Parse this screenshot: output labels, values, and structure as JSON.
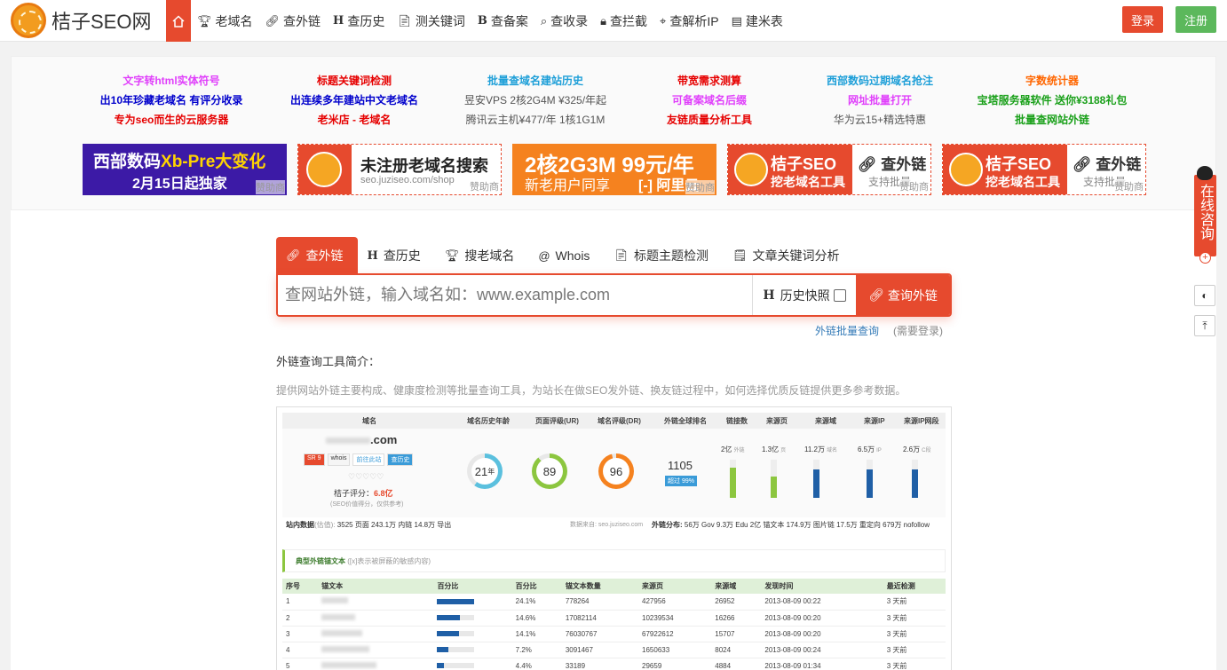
{
  "site": {
    "logo_text": "桔子SEO网"
  },
  "nav": {
    "items": [
      {
        "icon": "trophy-icon",
        "glyph": "🏆︎",
        "label": "老域名"
      },
      {
        "icon": "link-icon",
        "glyph": "🔗︎",
        "label": "查外链"
      },
      {
        "icon": "history-icon",
        "glyph": "H",
        "label": "查历史"
      },
      {
        "icon": "document-icon",
        "glyph": "📄︎",
        "label": "测关键词"
      },
      {
        "icon": "beian-icon",
        "glyph": "B",
        "label": "查备案"
      },
      {
        "icon": "search-icon",
        "glyph": "⌕",
        "label": "查收录"
      },
      {
        "icon": "lock-icon",
        "glyph": "🔒︎",
        "label": "查拦截"
      },
      {
        "icon": "location-icon",
        "glyph": "⌖",
        "label": "查解析IP"
      },
      {
        "icon": "table-icon",
        "glyph": "▤",
        "label": "建米表"
      }
    ],
    "login": "登录",
    "register": "注册"
  },
  "ads": {
    "columns": [
      [
        "文字转html实体符号",
        "出10年珍藏老域名 有评分收录",
        "专为seo而生的云服务器"
      ],
      [
        "标题关键词检测",
        "出连续多年建站中文老域名",
        "老米店 - 老域名"
      ],
      [
        "批量查域名建站历史",
        "昱安VPS 2核2G4M ¥325/年起",
        "腾讯云主机¥477/年 1核1G1M"
      ],
      [
        "带宽需求测算",
        "可备案域名后缀",
        "友链质量分析工具"
      ],
      [
        "西部数码过期域名抢注",
        "网址批量打开",
        "华为云15+精选特惠"
      ],
      [
        "字数统计器",
        "宝塔服务器软件 送你¥3188礼包",
        "批量查网站外链"
      ]
    ],
    "colors": [
      [
        "#e040fb",
        "#0000cc",
        "#e60000"
      ],
      [
        "#e60000",
        "#0000cc",
        "#e60000"
      ],
      [
        "#1e9fd8",
        "#555555",
        "#555555"
      ],
      [
        "#e60000",
        "#e040fb",
        "#e60000"
      ],
      [
        "#1e9fd8",
        "#e040fb",
        "#555555"
      ],
      [
        "#ff6600",
        "#1aa01a",
        "#1aa01a"
      ]
    ],
    "banners": {
      "b1_l1_pre": "西部数码",
      "b1_l1_hl": "Xb-Pre大变化",
      "b1_l2": "2月15日起独家",
      "b2_t1": "未注册老域名搜索",
      "b2_t2": "seo.juziseo.com/shop",
      "b3_t1": "2核2G3M 99元/年",
      "b3_t2": "新老用户同享",
      "b3_t3": "[-] 阿里云",
      "b4_t1": "桔子SEO",
      "b4_t2": "挖老域名工具",
      "b4_wl": "🔗︎ 查外链",
      "b4_wl2": "支持批量",
      "sponsor": "赞助商"
    }
  },
  "tabs": [
    {
      "icon": "link-icon",
      "glyph": "🔗︎",
      "label": "查外链"
    },
    {
      "icon": "history-icon",
      "glyph": "H",
      "label": "查历史"
    },
    {
      "icon": "trophy-icon",
      "glyph": "🏆︎",
      "label": "搜老域名"
    },
    {
      "icon": "at-icon",
      "glyph": "@",
      "label": "Whois"
    },
    {
      "icon": "document-icon",
      "glyph": "📄︎",
      "label": "标题主题检测"
    },
    {
      "icon": "note-icon",
      "glyph": "🗒︎",
      "label": "文章关键词分析"
    }
  ],
  "search": {
    "placeholder": "查网站外链，输入域名如：www.example.com",
    "history_label": "历史快照",
    "button_label": "查询外链",
    "batch_link": "外链批量查询",
    "need_login": "(需要登录)"
  },
  "intro": {
    "title": "外链查询工具简介：",
    "desc": "提供网站外链主要构成、健康度检测等批量查询工具，为站长在做SEO发外链、换友链过程中，如何选择优质反链提供更多参考数据。"
  },
  "preview": {
    "headers": [
      "域名",
      "域名历史年龄",
      "页面评级(UR)",
      "域名评级(DR)",
      "外链全球排名",
      "链接数",
      "来源页",
      "来源域",
      "来源IP",
      "来源IP网段"
    ],
    "domain_suffix": ".com",
    "score_label": "桔子评分：",
    "score_value": "6.8亿",
    "score_note": "(SEO价值得分，仅供参考)",
    "tags": [
      "SR 9",
      "whois",
      "前往此站",
      "查历史"
    ],
    "gauges": [
      21,
      89,
      96
    ],
    "gauge_unit": "年",
    "rank": "1105",
    "rank_badge": "超过 99%",
    "link_stats": [
      {
        "value": "2亿",
        "unit": "外链"
      },
      {
        "value": "1.3亿",
        "unit": "页"
      },
      {
        "value": "11.2万",
        "unit": "域名"
      },
      {
        "value": "6.5万",
        "unit": "IP"
      },
      {
        "value": "2.6万",
        "unit": "C段"
      }
    ],
    "bar_levels": [
      0.8,
      0.55,
      0.75,
      0.75,
      0.75
    ],
    "bar_colors": [
      "#8cc63f",
      "#8cc63f",
      "#1f5fa6",
      "#1f5fa6",
      "#1f5fa6"
    ],
    "site_data_label": "站内数据",
    "site_data_sub": "(估值):",
    "site_data": "3525 页面   243.1万 内链   14.8万 导出",
    "data_source": "数据来自: seo.juziseo.com",
    "link_dist_label": "外链分布:",
    "link_dist": "56万 Gov   9.3万 Edu   2亿 锚文本   174.9万 图片链   17.5万 重定向   679万 nofollow",
    "anchor_section": "典型外链锚文本",
    "anchor_note": "([x]表示被屏蔽的敏感内容)",
    "table_headers": [
      "序号",
      "锚文本",
      "百分比",
      "百分比",
      "锚文本数量",
      "来源页",
      "来源域",
      "发现时间",
      "最近检测"
    ],
    "rows": [
      [
        "1",
        "24.1%",
        "778264",
        "427956",
        "26952",
        "2013-08-09 00:22",
        "3 天前"
      ],
      [
        "2",
        "14.6%",
        "17082114",
        "10239534",
        "16266",
        "2013-08-09 00:20",
        "3 天前"
      ],
      [
        "3",
        "14.1%",
        "76030767",
        "67922612",
        "15707",
        "2013-08-09 00:20",
        "3 天前"
      ],
      [
        "4",
        "7.2%",
        "3091467",
        "1650633",
        "8024",
        "2013-08-09 00:24",
        "3 天前"
      ],
      [
        "5",
        "4.4%",
        "33189",
        "29659",
        "4884",
        "2013-08-09 01:34",
        "3 天前"
      ]
    ],
    "row_pct": [
      0.241,
      0.146,
      0.141,
      0.072,
      0.044
    ]
  },
  "side": {
    "chat_label": "在线咨询",
    "plus": "+"
  }
}
